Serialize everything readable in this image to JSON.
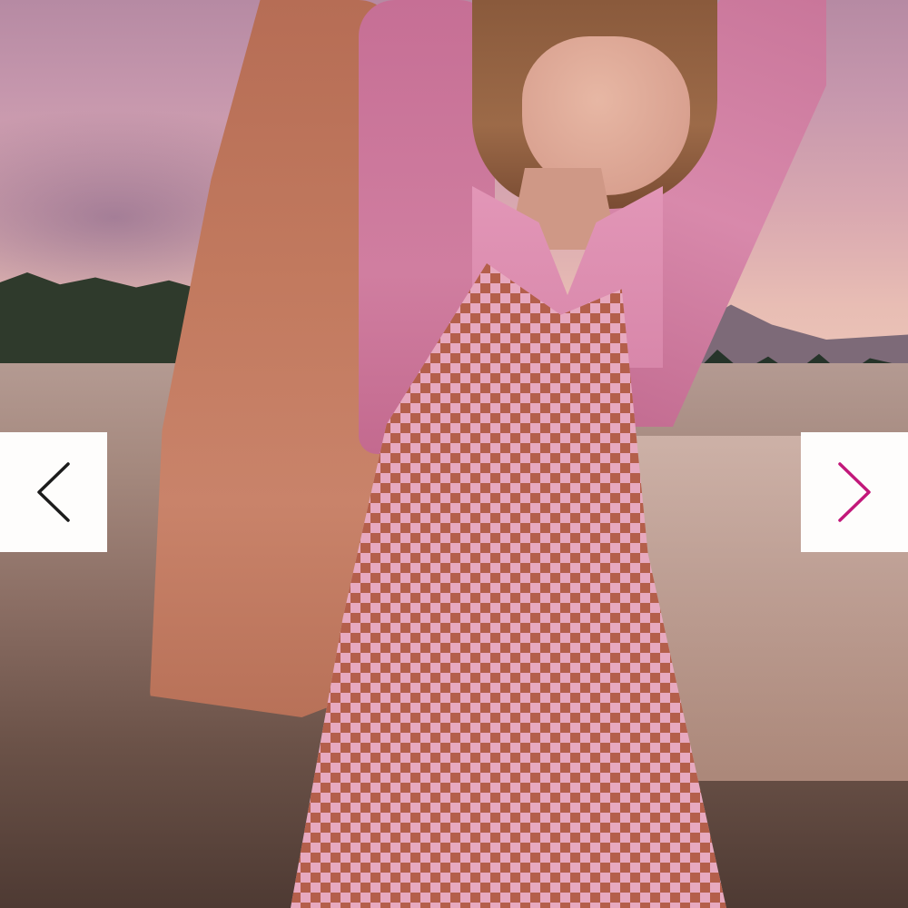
{
  "carousel": {
    "prev_button": {
      "icon": "chevron-left-icon",
      "color": "#1c1c1c"
    },
    "next_button": {
      "icon": "chevron-right-icon",
      "color": "#c2187a"
    }
  },
  "image": {
    "subject": "product-photo"
  },
  "colors": {
    "button_bg": "#fefdfc",
    "prev_arrow": "#1c1c1c",
    "next_arrow": "#c2187a"
  }
}
